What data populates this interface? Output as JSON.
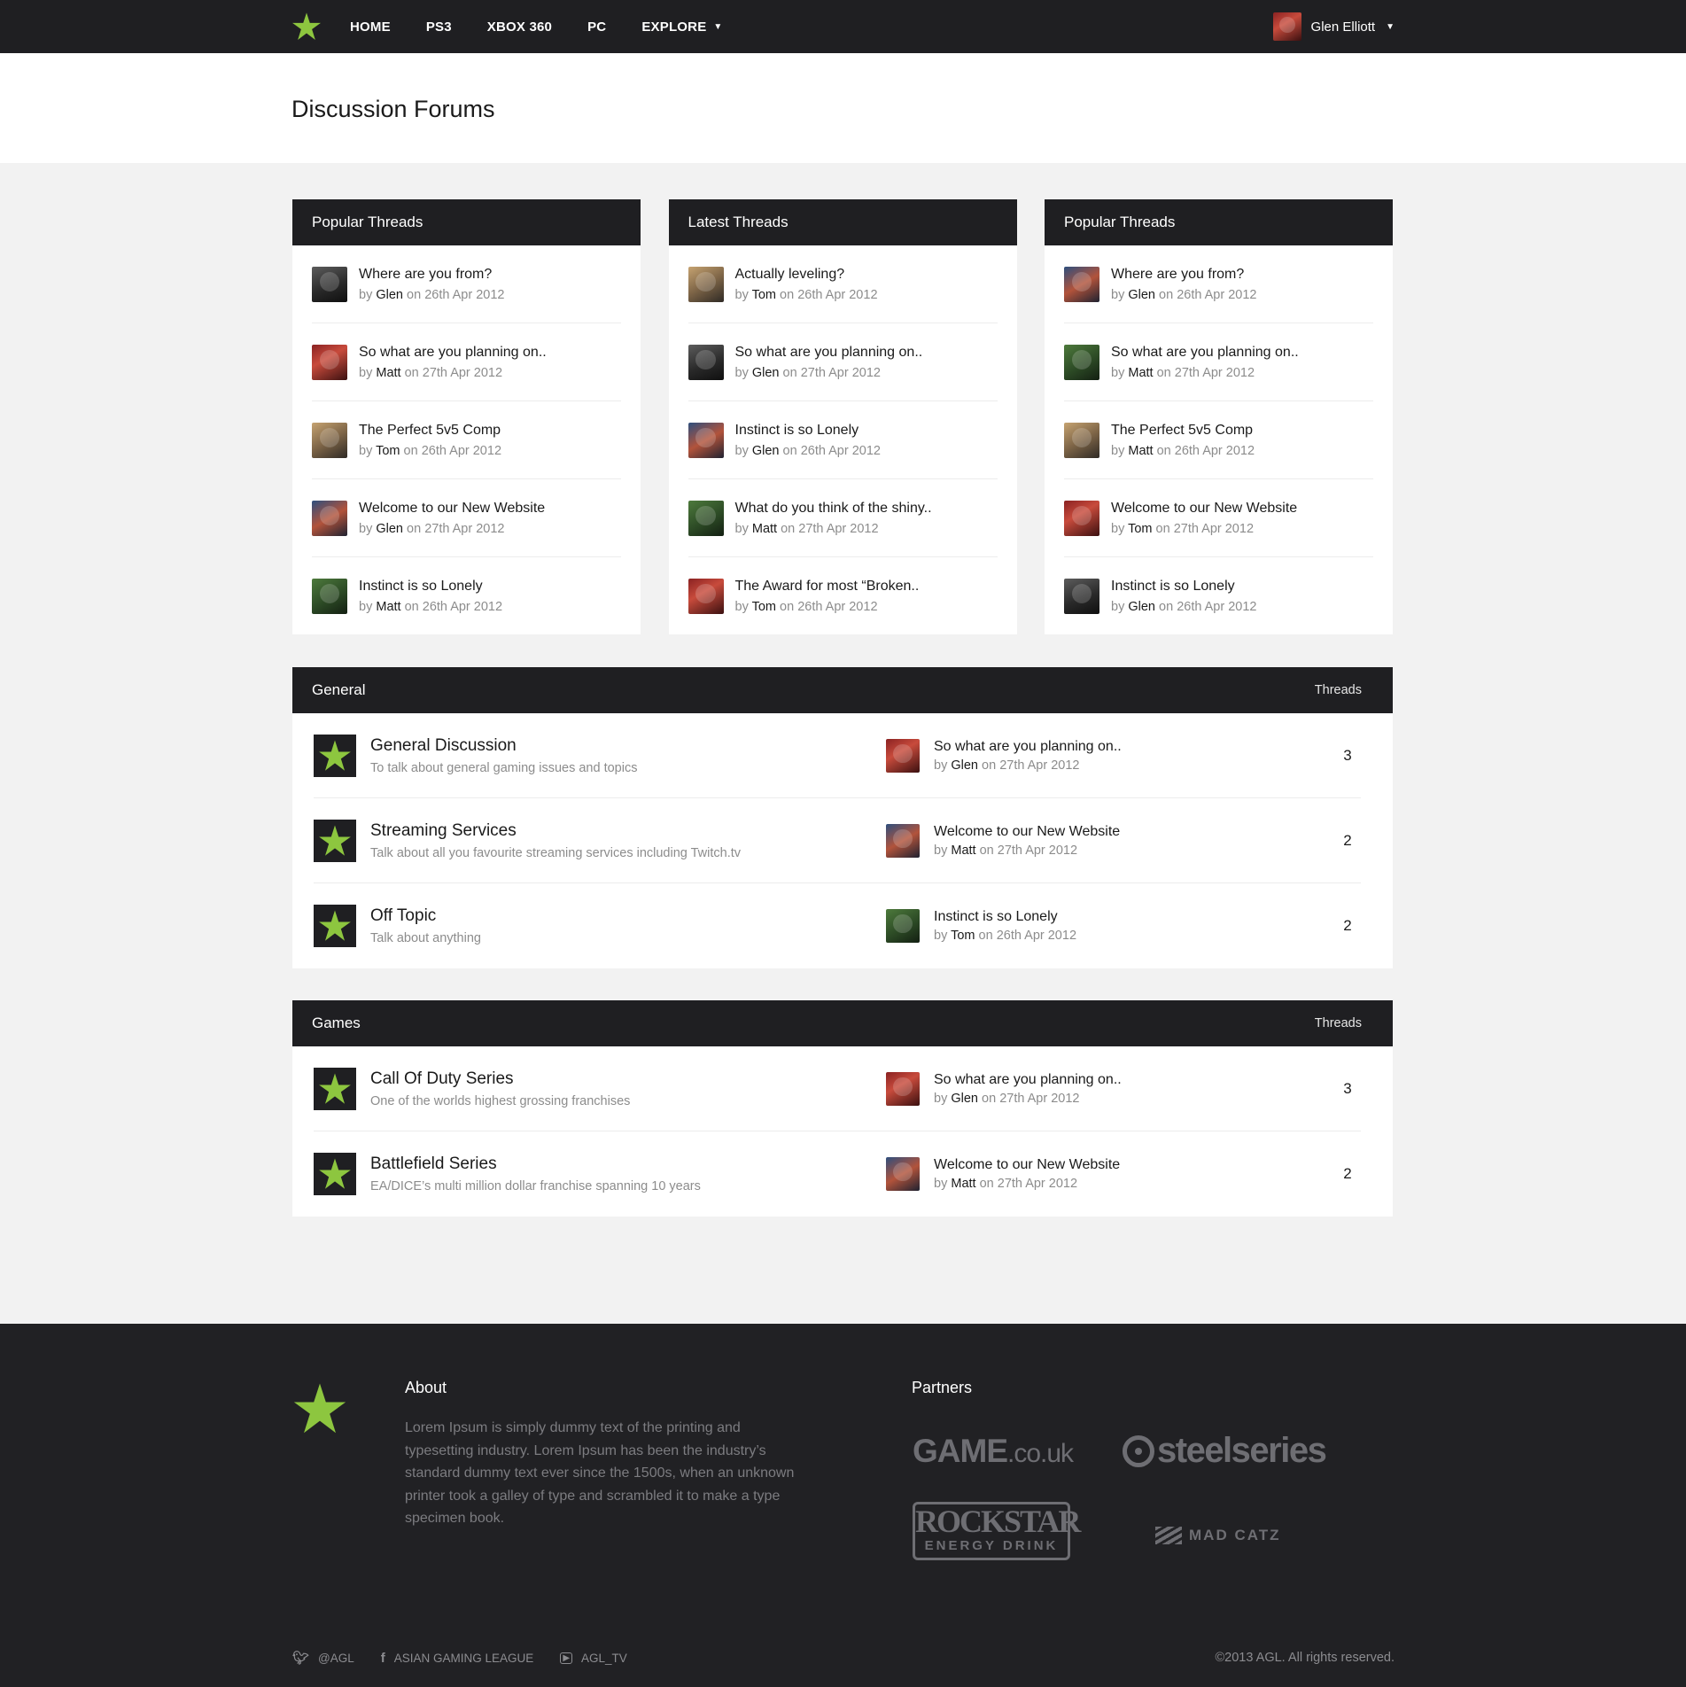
{
  "nav": {
    "links": [
      {
        "label": "HOME"
      },
      {
        "label": "PS3"
      },
      {
        "label": "XBOX 360"
      },
      {
        "label": "PC"
      },
      {
        "label": "EXPLORE"
      }
    ],
    "user_name": "Glen Elliott"
  },
  "page": {
    "title": "Discussion Forums"
  },
  "cards": [
    {
      "title": "Popular Threads",
      "threads": [
        {
          "title": "Where are you from?",
          "by": "by",
          "author": "Glen",
          "on": "on 26th Apr 2012",
          "avatar": "av-glen"
        },
        {
          "title": "So what are you planning on..",
          "by": "by",
          "author": "Matt",
          "on": "on 27th Apr 2012",
          "avatar": "av-matt"
        },
        {
          "title": "The Perfect 5v5 Comp",
          "by": "by",
          "author": "Tom",
          "on": "on 26th Apr 2012",
          "avatar": "av-tom"
        },
        {
          "title": "Welcome to our New Website",
          "by": "by",
          "author": "Glen",
          "on": "on 27th Apr 2012",
          "avatar": "av-widow"
        },
        {
          "title": "Instinct is so Lonely",
          "by": "by",
          "author": "Matt",
          "on": "on 26th Apr 2012",
          "avatar": "av-hulk"
        }
      ]
    },
    {
      "title": "Latest Threads",
      "threads": [
        {
          "title": "Actually leveling?",
          "by": "by",
          "author": "Tom",
          "on": "on 26th Apr 2012",
          "avatar": "av-tom"
        },
        {
          "title": "So what are you planning on..",
          "by": "by",
          "author": "Glen",
          "on": "on 27th Apr 2012",
          "avatar": "av-glen"
        },
        {
          "title": "Instinct is so Lonely",
          "by": "by",
          "author": "Glen",
          "on": "on 26th Apr 2012",
          "avatar": "av-widow"
        },
        {
          "title": "What do you think of the shiny..",
          "by": "by",
          "author": "Matt",
          "on": "on 27th Apr 2012",
          "avatar": "av-hulk"
        },
        {
          "title": "The Award for most “Broken..",
          "by": "by",
          "author": "Tom",
          "on": "on 26th Apr 2012",
          "avatar": "av-matt"
        }
      ]
    },
    {
      "title": "Popular Threads",
      "threads": [
        {
          "title": "Where are you from?",
          "by": "by",
          "author": "Glen",
          "on": "on 26th Apr 2012",
          "avatar": "av-widow"
        },
        {
          "title": "So what are you planning on..",
          "by": "by",
          "author": "Matt",
          "on": "on 27th Apr 2012",
          "avatar": "av-hulk"
        },
        {
          "title": "The Perfect 5v5 Comp",
          "by": "by",
          "author": "Matt",
          "on": "on 26th Apr 2012",
          "avatar": "av-tom"
        },
        {
          "title": "Welcome to our New Website",
          "by": "by",
          "author": "Tom",
          "on": "on 27th Apr 2012",
          "avatar": "av-matt"
        },
        {
          "title": "Instinct is so Lonely",
          "by": "by",
          "author": "Glen",
          "on": "on 26th Apr 2012",
          "avatar": "av-glen"
        }
      ]
    }
  ],
  "general": {
    "title": "General",
    "col_label": "Threads",
    "rows": [
      {
        "name": "General Discussion",
        "desc": "To talk about general gaming issues and topics",
        "last_title": "So what are you planning on..",
        "last_by": "by",
        "last_author": "Glen",
        "last_on": "on 27th Apr 2012",
        "avatar": "av-matt",
        "count": "3"
      },
      {
        "name": "Streaming Services",
        "desc": "Talk about all you favourite streaming services including Twitch.tv",
        "last_title": "Welcome to our New Website",
        "last_by": "by",
        "last_author": "Matt",
        "last_on": "on 27th Apr 2012",
        "avatar": "av-widow",
        "count": "2"
      },
      {
        "name": "Off Topic",
        "desc": "Talk about anything",
        "last_title": "Instinct is so Lonely",
        "last_by": "by",
        "last_author": "Tom",
        "last_on": "on 26th Apr 2012",
        "avatar": "av-hulk",
        "count": "2"
      }
    ]
  },
  "games": {
    "title": "Games",
    "col_label": "Threads",
    "rows": [
      {
        "name": "Call Of Duty Series",
        "desc": "One of the worlds highest grossing franchises",
        "last_title": "So what are you planning on..",
        "last_by": "by",
        "last_author": "Glen",
        "last_on": "on 27th Apr 2012",
        "avatar": "av-matt",
        "count": "3"
      },
      {
        "name": "Battlefield Series",
        "desc": "EA/DICE’s multi million dollar franchise spanning 10 years",
        "last_title": "Welcome to our New Website",
        "last_by": "by",
        "last_author": "Matt",
        "last_on": "on 27th Apr 2012",
        "avatar": "av-widow",
        "count": "2"
      }
    ]
  },
  "footer": {
    "about_heading": "About",
    "about_text": "Lorem Ipsum is simply dummy text of the printing and typesetting industry. Lorem Ipsum has been the industry’s standard dummy text ever since the 1500s, when an unknown printer took a galley of type and scrambled it to make a type specimen book.",
    "partners_heading": "Partners",
    "partners": {
      "game": "GAME",
      "game_suffix": ".co.uk",
      "steelseries": "steelseries",
      "rockstar_1": "ROCKSTAR",
      "rockstar_2": "ENERGY DRINK",
      "madcatz": "MAD CATZ"
    },
    "social": [
      {
        "label": "@AGL",
        "icon": "twitter-icon"
      },
      {
        "label": "ASIAN GAMING LEAGUE",
        "icon": "facebook-icon"
      },
      {
        "label": "AGL_TV",
        "icon": "youtube-icon"
      }
    ],
    "copyright": "©2013 AGL. All rights reserved."
  },
  "colors": {
    "accent": "#8dc63f",
    "dark": "#1f1f22",
    "muted": "#8c8c8c"
  }
}
